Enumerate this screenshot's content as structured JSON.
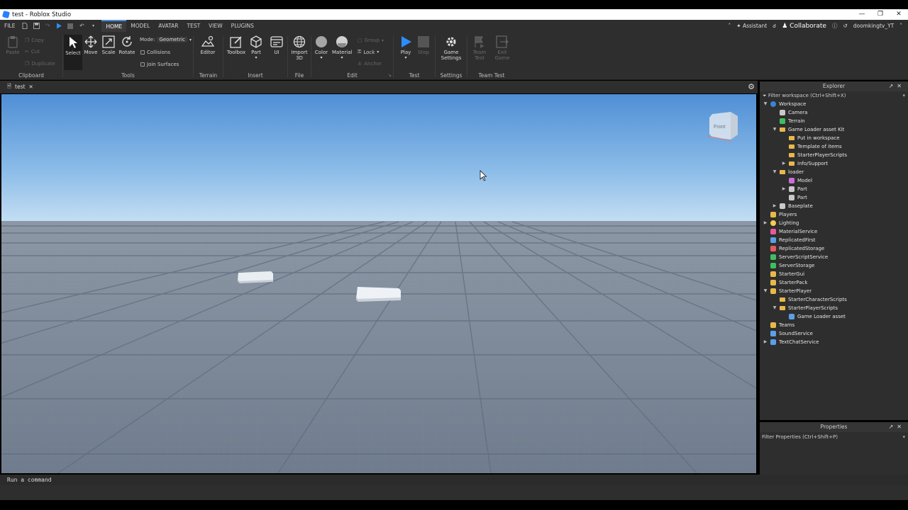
{
  "window": {
    "title": "test - Roblox Studio"
  },
  "menu": {
    "file": "FILE",
    "tabs": [
      {
        "label": "HOME",
        "active": true
      },
      {
        "label": "MODEL"
      },
      {
        "label": "AVATAR"
      },
      {
        "label": "TEST"
      },
      {
        "label": "VIEW"
      },
      {
        "label": "PLUGINS"
      }
    ],
    "assistant": "Assistant",
    "collaborate": "Collaborate",
    "user": "doomkingtv_YT"
  },
  "ribbon": {
    "clipboard": {
      "label": "Clipboard",
      "paste": "Paste",
      "copy": "Copy",
      "cut": "Cut",
      "duplicate": "Duplicate"
    },
    "tools": {
      "label": "Tools",
      "select": "Select",
      "move": "Move",
      "scale": "Scale",
      "rotate": "Rotate",
      "mode_label": "Mode:",
      "mode_value": "Geometric",
      "collisions": "Collisions",
      "join_surfaces": "Join Surfaces"
    },
    "terrain": {
      "label": "Terrain",
      "editor": "Editor"
    },
    "insert": {
      "label": "Insert",
      "toolbox": "Toolbox",
      "part": "Part",
      "ui": "UI"
    },
    "file": {
      "label": "File",
      "import_line1": "Import",
      "import_line2": "3D"
    },
    "edit": {
      "label": "Edit",
      "color": "Color",
      "material": "Material",
      "group": "Group",
      "lock": "Lock",
      "anchor": "Anchor"
    },
    "test": {
      "label": "Test",
      "play": "Play",
      "stop": "Stop"
    },
    "settings": {
      "label": "Settings",
      "game_line1": "Game",
      "game_line2": "Settings"
    },
    "team_test": {
      "label": "Team Test",
      "team_line1": "Team",
      "team_line2": "Test",
      "exit_line1": "Exit",
      "exit_line2": "Game"
    }
  },
  "doc_tab": {
    "label": "test"
  },
  "viewport": {
    "view_cube": "Front"
  },
  "command_bar": {
    "placeholder": "Run a command"
  },
  "explorer": {
    "title": "Explorer",
    "filter": "Filter workspace (Ctrl+Shift+X)",
    "rows": [
      {
        "label": "Workspace",
        "depth": 0,
        "arrow": "open",
        "icon": "globe-icon",
        "color": "#3b82d6"
      },
      {
        "label": "Camera",
        "depth": 1,
        "arrow": "",
        "icon": "camera-icon",
        "color": "#c9c9c9"
      },
      {
        "label": "Terrain",
        "depth": 1,
        "arrow": "",
        "icon": "terrain-icon",
        "color": "#3fbf5f"
      },
      {
        "label": "Game Loader asset Kit",
        "depth": 1,
        "arrow": "open",
        "icon": "folder-icon",
        "color": "#e8b84a"
      },
      {
        "label": "Put in workspace",
        "depth": 2,
        "arrow": "",
        "icon": "folder-icon",
        "color": "#e8b84a"
      },
      {
        "label": "Template of items",
        "depth": 2,
        "arrow": "",
        "icon": "folder-icon",
        "color": "#e8b84a"
      },
      {
        "label": "StarterPlayerScripts",
        "depth": 2,
        "arrow": "",
        "icon": "folder-icon",
        "color": "#e8b84a"
      },
      {
        "label": "info/Support",
        "depth": 2,
        "arrow": "closed",
        "icon": "folder-icon",
        "color": "#e8b84a"
      },
      {
        "label": "loader",
        "depth": 1,
        "arrow": "open",
        "icon": "folder-icon",
        "color": "#e8b84a"
      },
      {
        "label": "Model",
        "depth": 2,
        "arrow": "",
        "icon": "model-icon",
        "color": "#c96fd8"
      },
      {
        "label": "Part",
        "depth": 2,
        "arrow": "closed",
        "icon": "part-icon",
        "color": "#c9c9c9"
      },
      {
        "label": "Part",
        "depth": 2,
        "arrow": "",
        "icon": "part-icon",
        "color": "#c9c9c9"
      },
      {
        "label": "Baseplate",
        "depth": 1,
        "arrow": "closed",
        "icon": "part-icon",
        "color": "#c9c9c9"
      },
      {
        "label": "Players",
        "depth": 0,
        "arrow": "",
        "icon": "players-icon",
        "color": "#e8b84a"
      },
      {
        "label": "Lighting",
        "depth": 0,
        "arrow": "closed",
        "icon": "bulb-icon",
        "color": "#f2d04a"
      },
      {
        "label": "MaterialService",
        "depth": 0,
        "arrow": "",
        "icon": "material-icon",
        "color": "#e85a9a"
      },
      {
        "label": "ReplicatedFirst",
        "depth": 0,
        "arrow": "",
        "icon": "replicated-icon",
        "color": "#5aa0e8"
      },
      {
        "label": "ReplicatedStorage",
        "depth": 0,
        "arrow": "",
        "icon": "storage-icon",
        "color": "#e85a5a"
      },
      {
        "label": "ServerScriptService",
        "depth": 0,
        "arrow": "",
        "icon": "script-service-icon",
        "color": "#3fbf5f"
      },
      {
        "label": "ServerStorage",
        "depth": 0,
        "arrow": "",
        "icon": "storage-icon",
        "color": "#3fbf5f"
      },
      {
        "label": "StarterGui",
        "depth": 0,
        "arrow": "",
        "icon": "gui-icon",
        "color": "#e8b84a"
      },
      {
        "label": "StarterPack",
        "depth": 0,
        "arrow": "",
        "icon": "pack-icon",
        "color": "#e8b84a"
      },
      {
        "label": "StarterPlayer",
        "depth": 0,
        "arrow": "open",
        "icon": "player-icon",
        "color": "#e8b84a"
      },
      {
        "label": "StarterCharacterScripts",
        "depth": 1,
        "arrow": "",
        "icon": "folder-icon",
        "color": "#e8b84a"
      },
      {
        "label": "StarterPlayerScripts",
        "depth": 1,
        "arrow": "open",
        "icon": "folder-icon",
        "color": "#e8b84a"
      },
      {
        "label": "Game Loader asset",
        "depth": 2,
        "arrow": "",
        "icon": "local-script-icon",
        "color": "#5aa0e8"
      },
      {
        "label": "Teams",
        "depth": 0,
        "arrow": "",
        "icon": "teams-icon",
        "color": "#e8b84a"
      },
      {
        "label": "SoundService",
        "depth": 0,
        "arrow": "",
        "icon": "sound-icon",
        "color": "#5aa0e8"
      },
      {
        "label": "TextChatService",
        "depth": 0,
        "arrow": "closed",
        "icon": "chat-icon",
        "color": "#5aa0e8"
      }
    ]
  },
  "properties": {
    "title": "Properties",
    "filter": "Filter Properties (Ctrl+Shift+P)"
  }
}
